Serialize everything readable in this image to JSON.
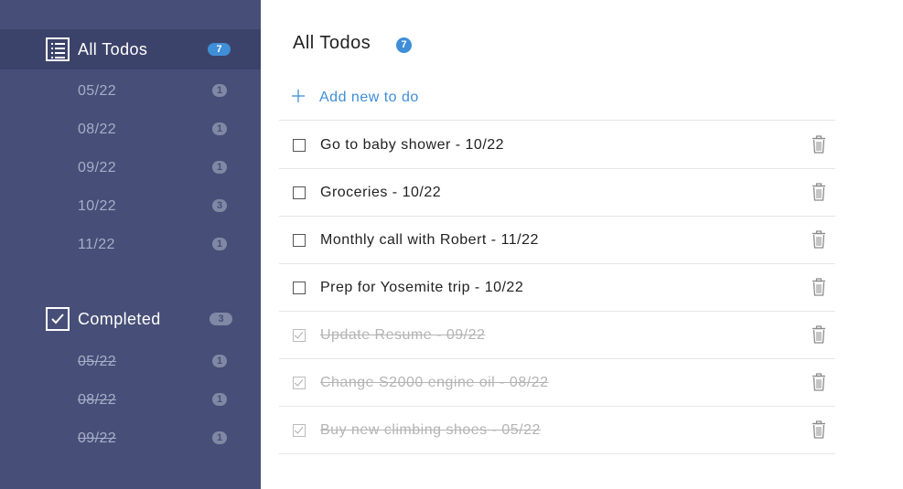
{
  "sidebar": {
    "all": {
      "title": "All Todos",
      "count": "7",
      "icon": "list-icon",
      "items": [
        {
          "label": "05/22",
          "count": "1"
        },
        {
          "label": "08/22",
          "count": "1"
        },
        {
          "label": "09/22",
          "count": "1"
        },
        {
          "label": "10/22",
          "count": "3"
        },
        {
          "label": "11/22",
          "count": "1"
        }
      ]
    },
    "completed": {
      "title": "Completed",
      "count": "3",
      "icon": "checkbox-checked-icon",
      "items": [
        {
          "label": "05/22",
          "count": "1"
        },
        {
          "label": "08/22",
          "count": "1"
        },
        {
          "label": "09/22",
          "count": "1"
        }
      ]
    }
  },
  "main": {
    "title": "All Todos",
    "count": "7",
    "add_label": "Add new to do",
    "add_icon": "plus-icon",
    "todos": [
      {
        "text": "Go to baby shower - 10/22",
        "done": false
      },
      {
        "text": "Groceries - 10/22",
        "done": false
      },
      {
        "text": "Monthly call with Robert - 11/22",
        "done": false
      },
      {
        "text": "Prep for Yosemite trip - 10/22",
        "done": false
      },
      {
        "text": "Update Resume - 09/22",
        "done": true
      },
      {
        "text": "Change S2000 engine oil - 08/22",
        "done": true
      },
      {
        "text": "Buy new climbing shoes - 05/22",
        "done": true
      }
    ]
  },
  "colors": {
    "sidebar_bg": "#474f78",
    "sidebar_active_bg": "#3c436a",
    "accent": "#3f8ed8",
    "completed_text": "#b4b4b4"
  }
}
